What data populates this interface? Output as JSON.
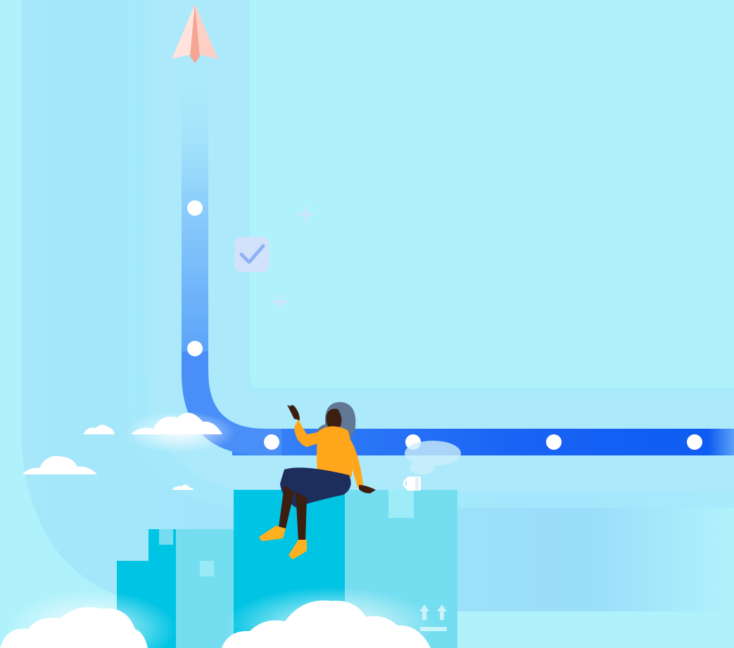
{
  "illustration": {
    "kind": "paper-plane-journey",
    "colors": {
      "background": "#b0f2fb",
      "outer_band": "#9fe3f8",
      "inner_band": "#a8ecfb",
      "path_light": "#8fd0fb",
      "path_dark": "#1a64f5",
      "plane": "#fcd6cc",
      "box_dark": "#00c4e4",
      "box_light": "#74def0",
      "cloud": "#ffffff",
      "shirt": "#ffa61a",
      "skirt": "#1d2d5c",
      "skin": "#3d1f12",
      "hair": "#607896",
      "shoes": "#ffb020"
    },
    "icons": [
      "paper-plane-icon",
      "checkbox-icon",
      "plus-icon",
      "plus-icon",
      "this-side-up-icon",
      "mug-icon"
    ],
    "path_stops": 6
  }
}
